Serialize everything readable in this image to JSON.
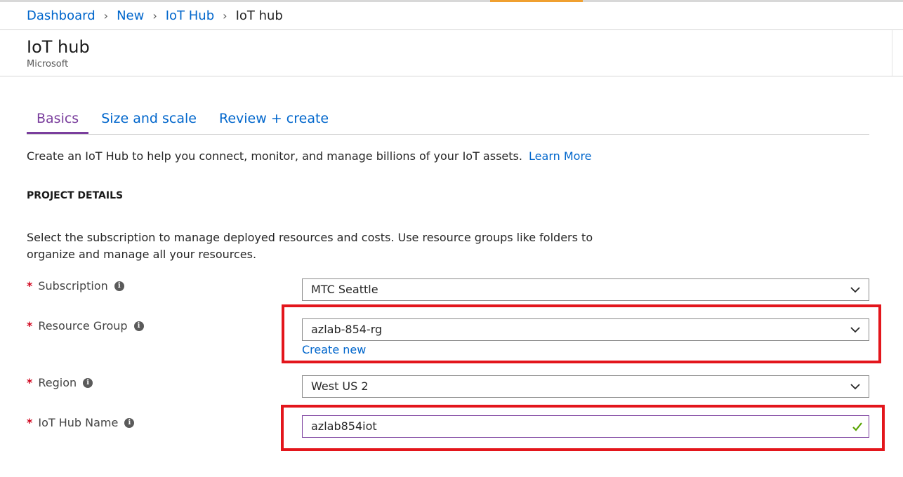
{
  "breadcrumb": {
    "items": [
      "Dashboard",
      "New",
      "IoT Hub"
    ],
    "current": "IoT hub"
  },
  "header": {
    "title": "IoT hub",
    "subtitle": "Microsoft"
  },
  "tabs": [
    {
      "label": "Basics",
      "active": true
    },
    {
      "label": "Size and scale",
      "active": false
    },
    {
      "label": "Review + create",
      "active": false
    }
  ],
  "intro": {
    "text": "Create an IoT Hub to help you connect, monitor, and manage billions of your IoT assets.",
    "link": "Learn More"
  },
  "project_details": {
    "title": "PROJECT DETAILS",
    "description": "Select the subscription to manage deployed resources and costs. Use resource groups like folders to organize and manage all your resources."
  },
  "fields": {
    "subscription": {
      "label": "Subscription",
      "value": "MTC Seattle",
      "required": "*"
    },
    "resource_group": {
      "label": "Resource Group",
      "value": "azlab-854-rg",
      "required": "*",
      "create_new": "Create new"
    },
    "region": {
      "label": "Region",
      "value": "West US 2",
      "required": "*"
    },
    "iot_hub_name": {
      "label": "IoT Hub Name",
      "value": "azlab854iot",
      "required": "*"
    }
  },
  "icons": {
    "info": "info-icon",
    "chevron": "chevron-down-icon",
    "valid": "checkmark-icon",
    "separator": "chevron-right-icon"
  },
  "colors": {
    "link": "#0066cc",
    "active_tab": "#7a3e9d",
    "required": "#d0021b",
    "highlight": "#e3161c",
    "valid_check": "#57a300"
  }
}
